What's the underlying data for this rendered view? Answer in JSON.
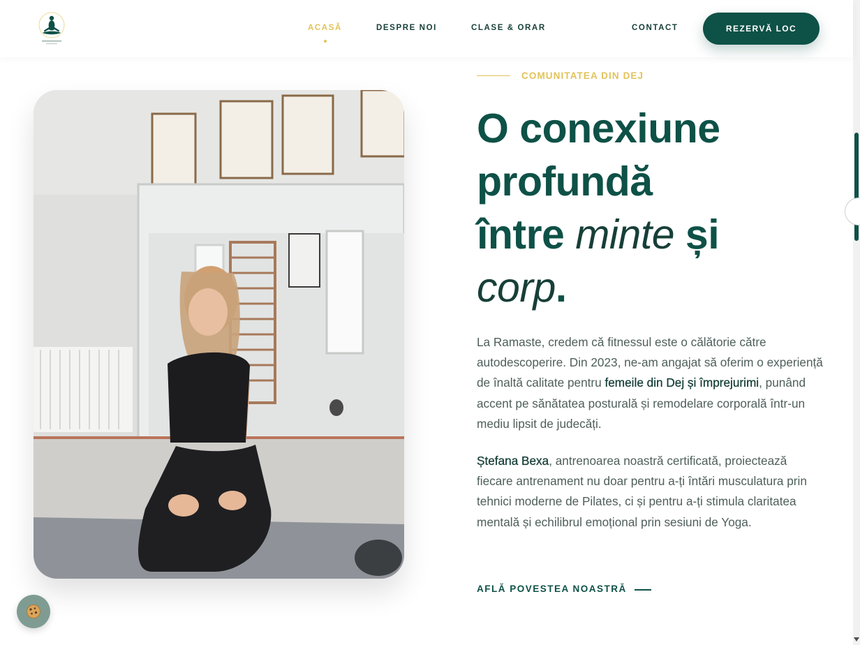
{
  "header": {
    "logo_alt": "Ramaste Fitness logo",
    "nav": [
      {
        "label": "ACASĂ",
        "active": true
      },
      {
        "label": "DESPRE NOI",
        "active": false
      },
      {
        "label": "CLASE & ORAR",
        "active": false
      },
      {
        "label": "CONTACT",
        "active": false
      }
    ],
    "cta_label": "REZERVĂ LOC"
  },
  "hero": {
    "eyebrow": "COMUNITATEA DIN DEJ",
    "headline": {
      "line1": "O conexiune",
      "line2": "profundă",
      "line3_a": "între ",
      "line3_em": "minte",
      "line3_b": " și",
      "line4_em": "corp",
      "line4_b": "."
    },
    "para1": {
      "a": "La Ramaste, credem că fitnessul este o călătorie către autodescoperire. Din 2023, ne-am angajat să oferim o experiență de înaltă calitate pentru ",
      "strong": "femeile din Dej și împrejurimi",
      "b": ", punând accent pe sănătatea posturală și remodelare corporală într-un mediu lipsit de judecăți."
    },
    "para2": {
      "strong": "Ștefana Bexa",
      "a": ", antrenoarea noastră certificată, proiectează fiecare antrenament nu doar pentru a-ți întări musculatura prin tehnici moderne de Pilates, ci și pentru a-ți stimula claritatea mentală și echilibrul emoțional prin sesiuni de Yoga."
    },
    "link_label": "AFLĂ POVESTEA NOASTRĂ"
  },
  "colors": {
    "brand": "#0e5147",
    "accent": "#e2c35a",
    "cookie_bg": "#7f9c93"
  },
  "icons": {
    "cookie": "cookie-icon",
    "logo": "meditation-figure-icon"
  }
}
